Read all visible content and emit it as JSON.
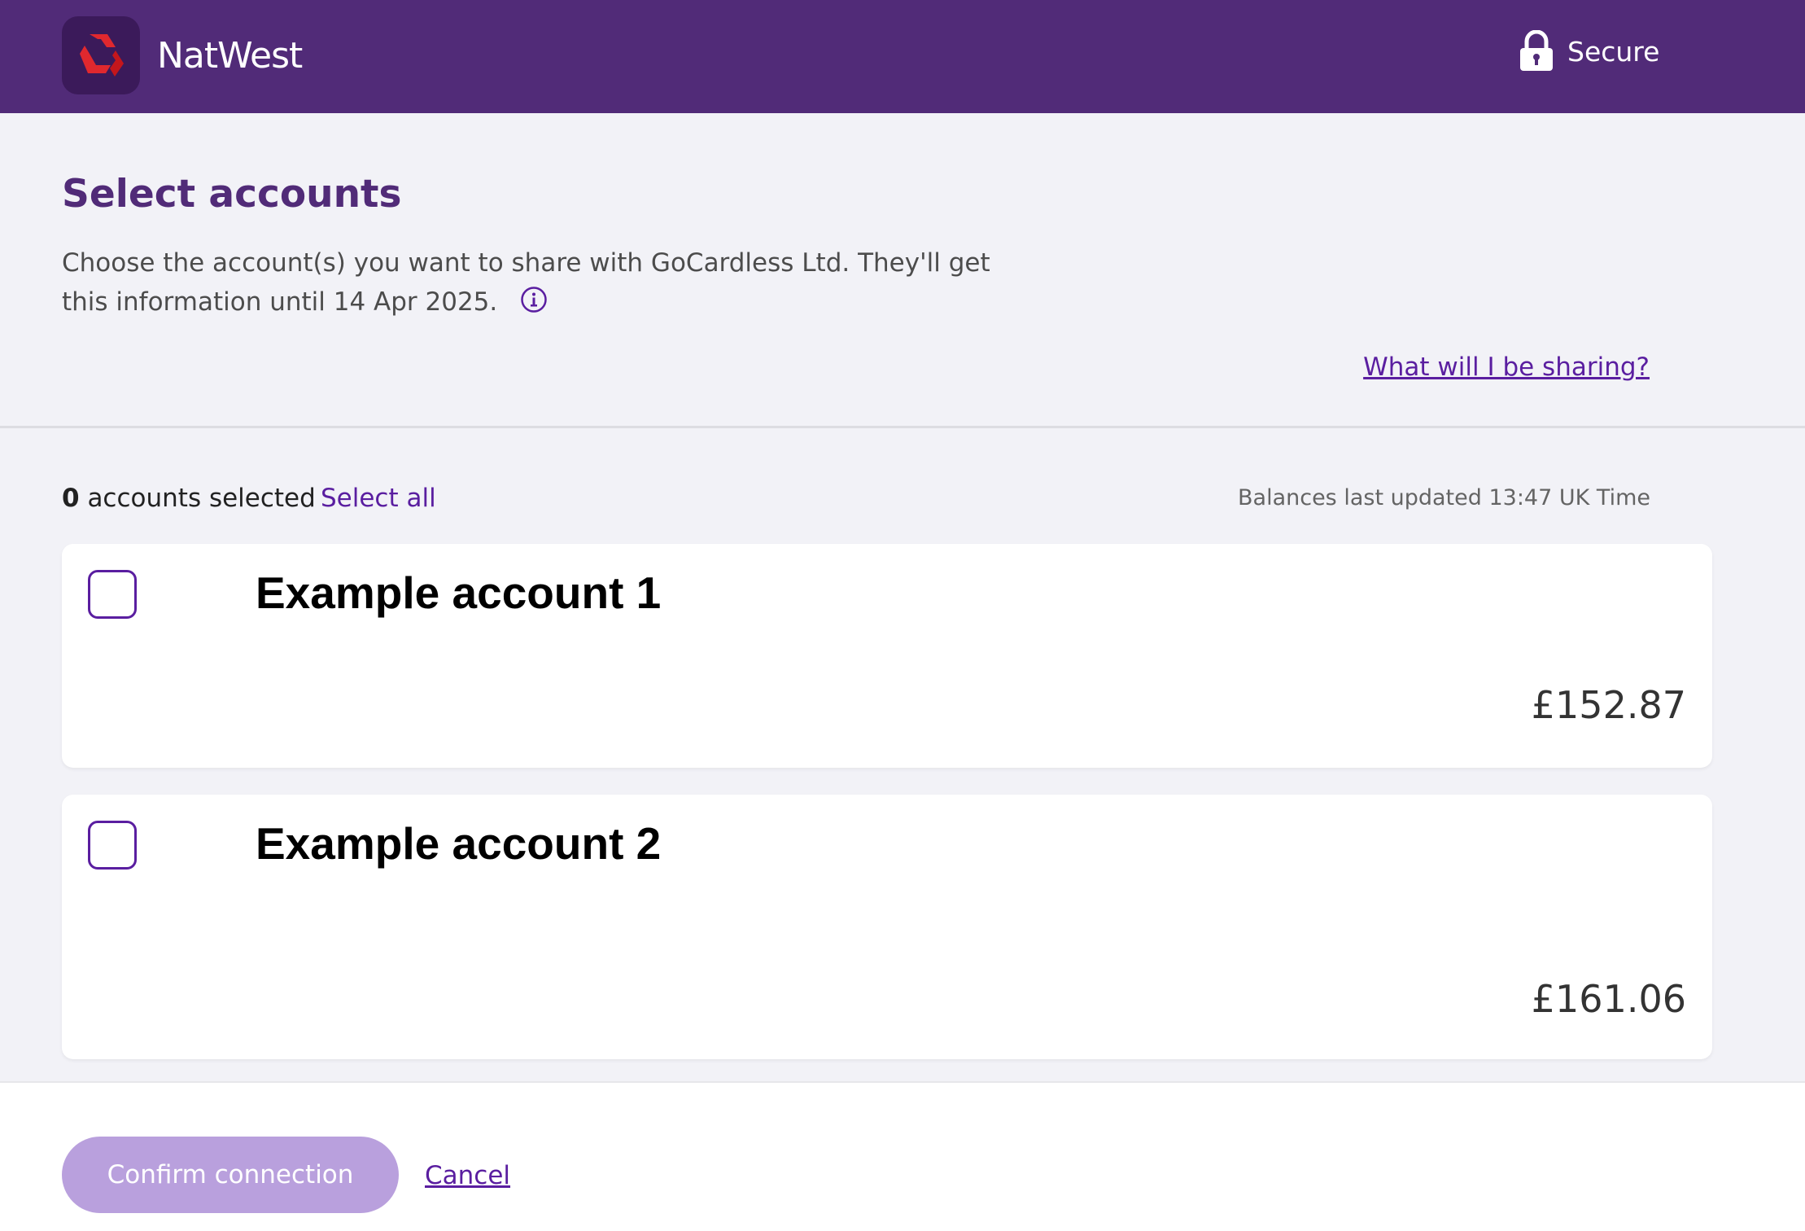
{
  "header": {
    "brand": "NatWest",
    "logo_icon": "natwest-cubes-logo",
    "secure_label": "Secure",
    "secure_icon": "padlock-icon"
  },
  "intro": {
    "title": "Select accounts",
    "description": "Choose the account(s) you want to share with GoCardless Ltd. They'll get this information until 14 Apr 2025.",
    "info_icon": "info-circle-icon",
    "share_link": "What will I be sharing?"
  },
  "summary": {
    "selected_count": "0",
    "selected_label": "accounts selected",
    "select_all": "Select all",
    "balances_updated": "Balances last updated 13:47 UK Time"
  },
  "accounts": [
    {
      "name": "Example account 1",
      "balance": "£152.87",
      "checked": false
    },
    {
      "name": "Example account 2",
      "balance": "£161.06",
      "checked": false
    }
  ],
  "footer": {
    "confirm_label": "Confirm connection",
    "cancel_label": "Cancel"
  },
  "colors": {
    "brand_purple": "#512b78",
    "link_purple": "#5a1ea0",
    "button_disabled": "#b9a0dd",
    "logo_red": "#e0282e"
  }
}
